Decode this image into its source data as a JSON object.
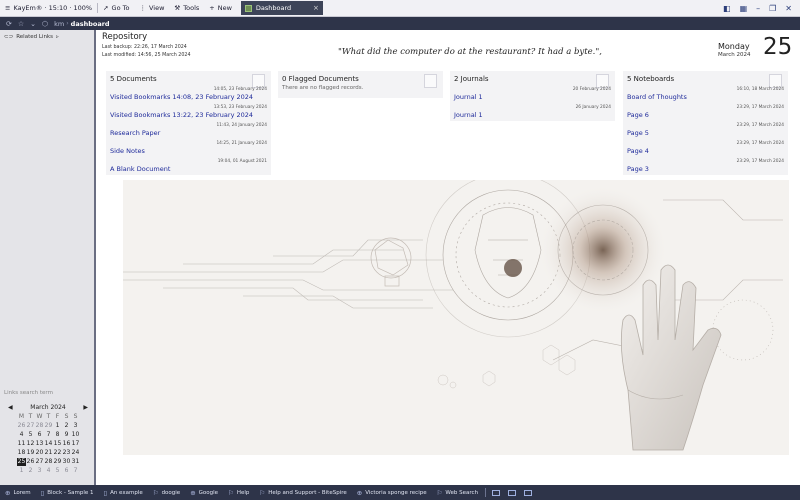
{
  "titlebar": {
    "app": "KayEm® · 15:10 · 100%",
    "goto": "Go To",
    "view": "View",
    "tools": "Tools",
    "new": "New",
    "tab": "Dashboard"
  },
  "address": {
    "crumb_root": "km",
    "crumb_active": "dashboard"
  },
  "sidebar": {
    "related_links": "Related Links",
    "search_placeholder": "Links search term"
  },
  "calendar": {
    "month_label": "March 2024",
    "weekdays": [
      "M",
      "T",
      "W",
      "T",
      "F",
      "S",
      "S"
    ],
    "weeks": [
      [
        {
          "d": "26",
          "dim": true
        },
        {
          "d": "27",
          "dim": true
        },
        {
          "d": "28",
          "dim": true
        },
        {
          "d": "29",
          "dim": true
        },
        {
          "d": "1"
        },
        {
          "d": "2"
        },
        {
          "d": "3"
        }
      ],
      [
        {
          "d": "4"
        },
        {
          "d": "5"
        },
        {
          "d": "6"
        },
        {
          "d": "7"
        },
        {
          "d": "8"
        },
        {
          "d": "9"
        },
        {
          "d": "10"
        }
      ],
      [
        {
          "d": "11"
        },
        {
          "d": "12"
        },
        {
          "d": "13"
        },
        {
          "d": "14"
        },
        {
          "d": "15"
        },
        {
          "d": "16"
        },
        {
          "d": "17"
        }
      ],
      [
        {
          "d": "18"
        },
        {
          "d": "19"
        },
        {
          "d": "20"
        },
        {
          "d": "21"
        },
        {
          "d": "22"
        },
        {
          "d": "23"
        },
        {
          "d": "24"
        }
      ],
      [
        {
          "d": "25",
          "sel": true
        },
        {
          "d": "26"
        },
        {
          "d": "27"
        },
        {
          "d": "28"
        },
        {
          "d": "29"
        },
        {
          "d": "30"
        },
        {
          "d": "31"
        }
      ],
      [
        {
          "d": "1",
          "dim": true
        },
        {
          "d": "2",
          "dim": true
        },
        {
          "d": "3",
          "dim": true
        },
        {
          "d": "4",
          "dim": true
        },
        {
          "d": "5",
          "dim": true
        },
        {
          "d": "6",
          "dim": true
        },
        {
          "d": "7",
          "dim": true
        }
      ]
    ]
  },
  "repo": {
    "title": "Repository",
    "last_backup": "Last backup: 22:26, 17 March 2024",
    "last_modified": "Last modified: 14:56, 25 March 2024",
    "quote": "\"What did the computer do at the restaurant? It had a byte.\","
  },
  "date": {
    "weekday": "Monday",
    "month": "March 2024",
    "day": "25"
  },
  "cards": [
    {
      "title": "5 Documents",
      "empty": "",
      "items": [
        {
          "ts": "14:05, 23 February 2024",
          "label": "Visited Bookmarks 14:08, 23 February 2024"
        },
        {
          "ts": "13:53, 23 February 2024",
          "label": "Visited Bookmarks 13:22, 23 February 2024"
        },
        {
          "ts": "11:43, 24 January 2024",
          "label": "Research Paper"
        },
        {
          "ts": "14:25, 21 January 2024",
          "label": "Side Notes"
        },
        {
          "ts": "19:04, 01 August 2021",
          "label": "A Blank Document"
        }
      ]
    },
    {
      "title": "0 Flagged Documents",
      "empty": "There are no flagged records.",
      "items": []
    },
    {
      "title": "2 Journals",
      "empty": "",
      "items": [
        {
          "ts": "20 February 2024",
          "label": "Journal 1"
        },
        {
          "ts": "26 January 2024",
          "label": "Journal 1"
        }
      ]
    },
    {
      "title": "5 Noteboards",
      "empty": "",
      "items": [
        {
          "ts": "16:10, 18 March 2024",
          "label": "Board of Thoughts"
        },
        {
          "ts": "23:29, 17 March 2024",
          "label": "Page 6"
        },
        {
          "ts": "23:29, 17 March 2024",
          "label": "Page 5"
        },
        {
          "ts": "23:29, 17 March 2024",
          "label": "Page 4"
        },
        {
          "ts": "23:29, 17 March 2024",
          "label": "Page 3"
        }
      ]
    }
  ],
  "taskbar": [
    {
      "label": "Lorem",
      "icon": "globe-icon"
    },
    {
      "label": "Block - Sample 1",
      "icon": "document-icon"
    },
    {
      "label": "An example",
      "icon": "document-icon"
    },
    {
      "label": "doogie",
      "icon": "flag-icon"
    },
    {
      "label": "Google",
      "icon": "globe-icon"
    },
    {
      "label": "Help",
      "icon": "flag-icon"
    },
    {
      "label": "Help and Support - BiteSpire",
      "icon": "flag-icon"
    },
    {
      "label": "Victoria sponge recipe",
      "icon": "globe-icon"
    },
    {
      "label": "Web Search",
      "icon": "flag-icon"
    }
  ],
  "colors": {
    "accent_dark": "#2e3449",
    "link_blue": "#1e2a9a",
    "sidebar_bg": "#e4e4e8",
    "card_bg": "#f3f3f5"
  }
}
